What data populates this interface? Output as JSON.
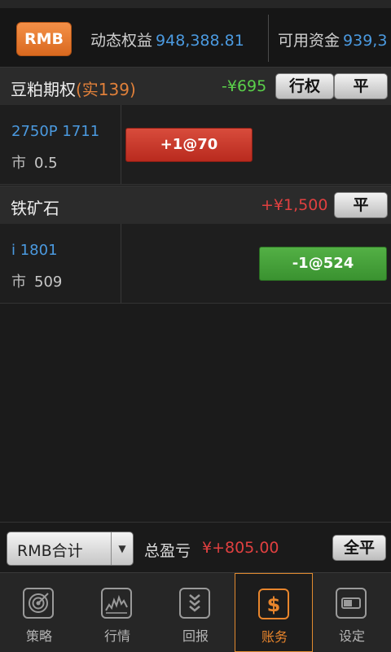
{
  "account": {
    "currency_button": "RMB",
    "dynamic_equity_label": "动态权益",
    "dynamic_equity_value": "948,388.81",
    "available_funds_label": "可用资金",
    "available_funds_value": "939,3"
  },
  "groups": [
    {
      "name": "豆粕期权",
      "sub": "(实139)",
      "pnl": "-¥695",
      "exercise_label": "行权",
      "close_label": "平",
      "position": {
        "code": "2750P 1711",
        "market_label": "市",
        "market_value": "0.5",
        "order_label": "+1@70"
      }
    },
    {
      "name": "铁矿石",
      "pnl": "+¥1,500",
      "close_label": "平",
      "position": {
        "code": "i 1801",
        "market_label": "市",
        "market_value": "509",
        "order_label": "-1@524"
      }
    }
  ],
  "summary": {
    "select_value": "RMB合计",
    "total_label": "总盈亏",
    "total_value": "¥+805.00",
    "close_all_label": "全平"
  },
  "tabs": [
    {
      "label": "策略",
      "icon": "target-icon"
    },
    {
      "label": "行情",
      "icon": "chart-icon"
    },
    {
      "label": "回报",
      "icon": "download-icon"
    },
    {
      "label": "账务",
      "icon": "dollar-icon",
      "active": true
    },
    {
      "label": "设定",
      "icon": "settings-icon"
    }
  ],
  "colors": {
    "accent": "#e8852c",
    "profit_green": "#5ad04a",
    "loss_red": "#e04040",
    "link_blue": "#4b9ae0"
  }
}
